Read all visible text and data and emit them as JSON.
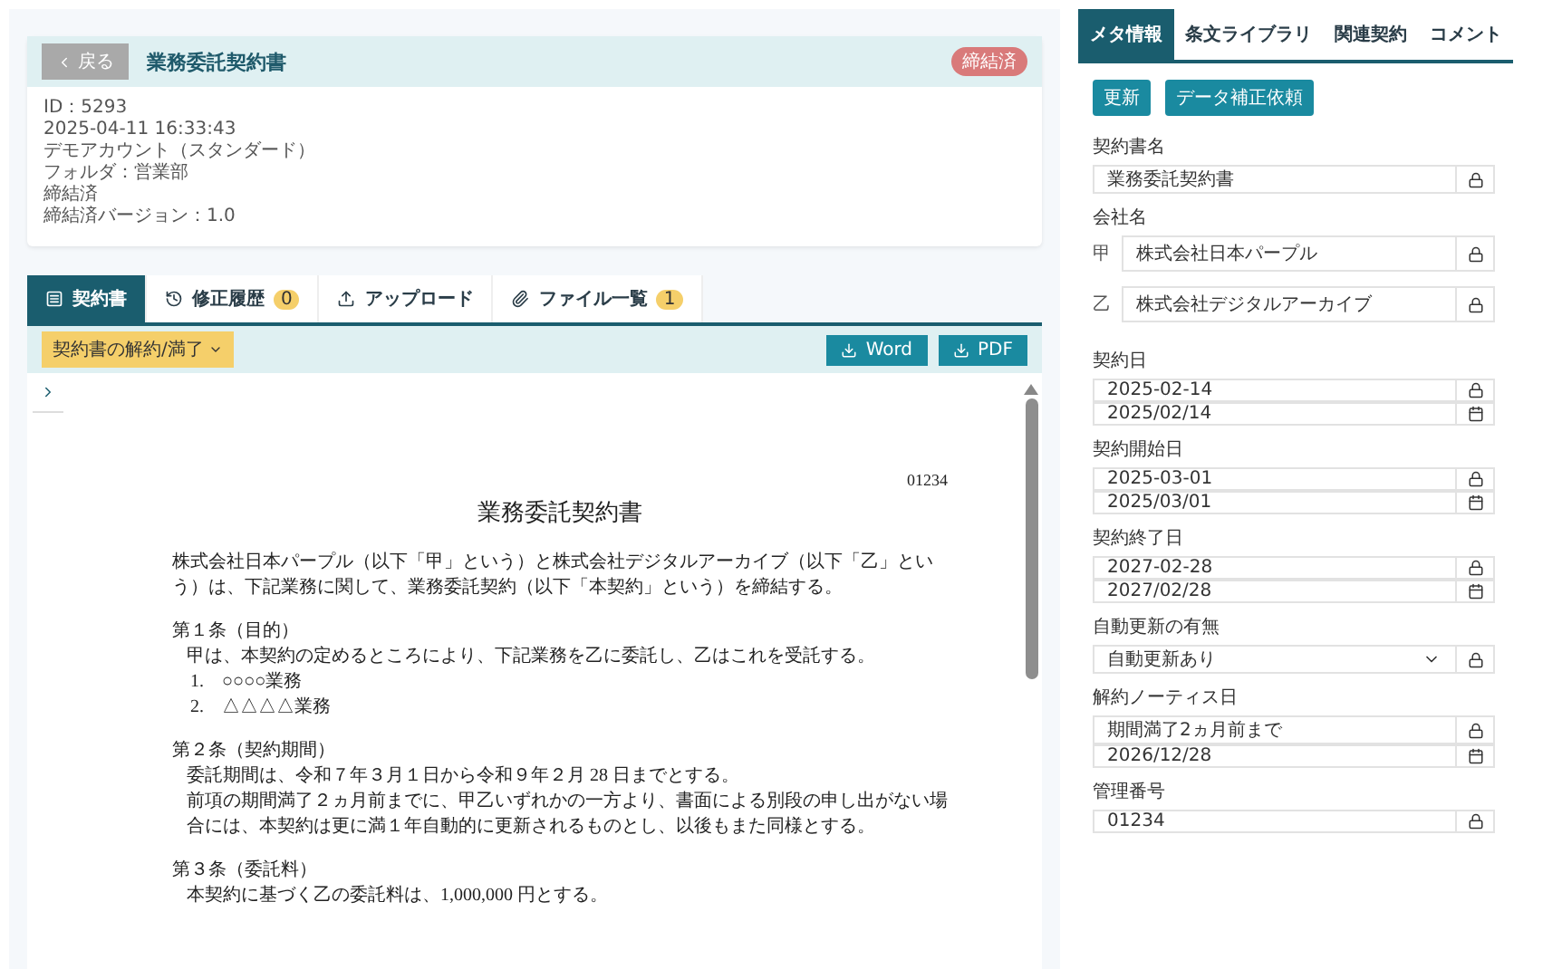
{
  "header": {
    "back": "戻る",
    "title": "業務委託契約書",
    "status": "締結済",
    "info": [
      "ID：5293",
      "2025-04-11 16:33:43",
      "デモアカウント（スタンダード）",
      "フォルダ：営業部",
      "締結済",
      "締結済バージョン：1.0"
    ]
  },
  "tabs": [
    {
      "kind": "document",
      "label": "契約書",
      "selected": true
    },
    {
      "kind": "history",
      "label": "修正履歴",
      "badge": "0",
      "selected": false
    },
    {
      "kind": "upload",
      "label": "アップロード",
      "selected": false
    },
    {
      "kind": "files",
      "label": "ファイル一覧",
      "badge": "1",
      "selected": false
    }
  ],
  "toolbar": {
    "menu": "契約書の解約/満了",
    "downloads": [
      "Word",
      "PDF"
    ]
  },
  "document": {
    "number": "01234",
    "title": "業務委託契約書",
    "blocks": [
      {
        "kind": "para",
        "text": "株式会社日本パープル（以下「甲」という）と株式会社デジタルアーカイブ（以下「乙」という）は、下記業務に関して、業務委託契約（以下「本契約」という）を締結する。"
      },
      {
        "kind": "heading",
        "text": "第１条（目的）"
      },
      {
        "kind": "body",
        "text": "甲は、本契約の定めるところにより、下記業務を乙に委託し、乙はこれを受託する。"
      },
      {
        "kind": "item",
        "num": "1.",
        "text": "○○○○業務"
      },
      {
        "kind": "item",
        "num": "2.",
        "text": "△△△△業務"
      },
      {
        "kind": "heading",
        "text": "第２条（契約期間）"
      },
      {
        "kind": "body",
        "text": "委託期間は、令和７年３月１日から令和９年２月 28 日までとする。"
      },
      {
        "kind": "body",
        "text": "前項の期間満了２ヵ月前までに、甲乙いずれかの一方より、書面による別段の申し出がない場合には、本契約は更に満１年自動的に更新されるものとし、以後もまた同様とする。"
      },
      {
        "kind": "heading",
        "text": "第３条（委託料）"
      },
      {
        "kind": "body",
        "text": "本契約に基づく乙の委託料は、1,000,000 円とする。"
      }
    ]
  },
  "side_tabs": [
    {
      "label": "メタ情報",
      "selected": true
    },
    {
      "label": "条文ライブラリ",
      "selected": false
    },
    {
      "label": "関連契約",
      "selected": false
    },
    {
      "label": "コメント",
      "selected": false
    }
  ],
  "actions": [
    "更新",
    "データ補正依頼"
  ],
  "fields": [
    {
      "kind": "text",
      "label": "契約書名",
      "value": "業務委託契約書"
    },
    {
      "kind": "parties",
      "label": "会社名",
      "parties": [
        {
          "prefix": "甲",
          "value": "株式会社日本パープル"
        },
        {
          "prefix": "乙",
          "value": "株式会社デジタルアーカイブ"
        }
      ]
    },
    {
      "kind": "date",
      "label": "契約日",
      "value": "2025-02-14",
      "date": "2025/02/14"
    },
    {
      "kind": "date",
      "label": "契約開始日",
      "value": "2025-03-01",
      "date": "2025/03/01"
    },
    {
      "kind": "date",
      "label": "契約終了日",
      "value": "2027-02-28",
      "date": "2027/02/28"
    },
    {
      "kind": "select",
      "label": "自動更新の有無",
      "value": "自動更新あり"
    },
    {
      "kind": "date",
      "label": "解約ノーティス日",
      "value": "期間満了2ヵ月前まで",
      "date": "2026/12/28"
    },
    {
      "kind": "text",
      "label": "管理番号",
      "value": "01234"
    }
  ]
}
